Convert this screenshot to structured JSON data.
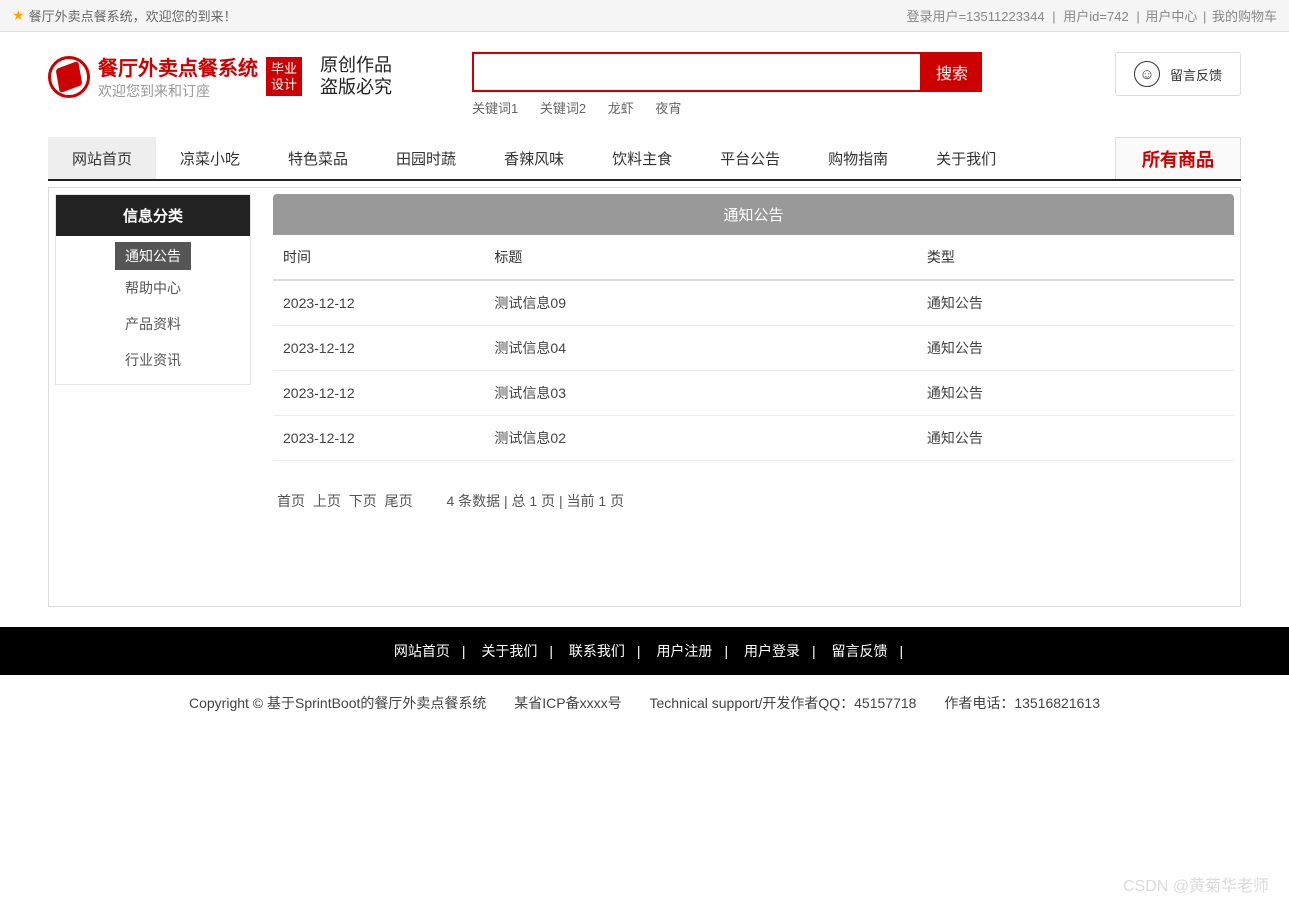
{
  "topbar": {
    "welcome": "餐厅外卖点餐系统，欢迎您的到来！",
    "login_user_label": "登录用户=13511223344",
    "user_id_label": "用户id=742",
    "user_center": "用户中心",
    "my_cart": "我的购物车",
    "sep": "|"
  },
  "header": {
    "title": "餐厅外卖点餐系统",
    "subtitle": "欢迎您到来和订座",
    "badge_line1": "毕业",
    "badge_line2": "设计",
    "slogan_line1": "原创作品",
    "slogan_line2": "盗版必究",
    "search_btn": "搜索",
    "keywords": [
      "关键词1",
      "关键词2",
      "龙虾",
      "夜宵"
    ],
    "msg_btn": "留言反馈"
  },
  "nav": {
    "items": [
      "网站首页",
      "凉菜小吃",
      "特色菜品",
      "田园时蔬",
      "香辣风味",
      "饮料主食",
      "平台公告",
      "购物指南",
      "关于我们"
    ],
    "all": "所有商品"
  },
  "sidebar": {
    "header": "信息分类",
    "items": [
      "通知公告",
      "帮助中心",
      "产品资料",
      "行业资讯"
    ]
  },
  "panel": {
    "title": "通知公告",
    "columns": {
      "time": "时间",
      "title": "标题",
      "type": "类型"
    },
    "rows": [
      {
        "time": "2023-12-12",
        "title": "测试信息09",
        "type": "通知公告"
      },
      {
        "time": "2023-12-12",
        "title": "测试信息04",
        "type": "通知公告"
      },
      {
        "time": "2023-12-12",
        "title": "测试信息03",
        "type": "通知公告"
      },
      {
        "time": "2023-12-12",
        "title": "测试信息02",
        "type": "通知公告"
      }
    ],
    "pager": {
      "first": "首页",
      "prev": "上页",
      "next": "下页",
      "last": "尾页",
      "info": "4 条数据 | 总 1 页 | 当前 1 页"
    }
  },
  "footer": {
    "links": [
      "网站首页",
      "关于我们",
      "联系我们",
      "用户注册",
      "用户登录",
      "留言反馈"
    ],
    "sep": "|",
    "copyright": "Copyright © 基于SprintBoot的餐厅外卖点餐系统",
    "icp": "某省ICP备xxxx号",
    "support": "Technical support/开发作者QQ：45157718",
    "tel": "作者电话：13516821613"
  },
  "watermark": "CSDN @黄菊华老师"
}
